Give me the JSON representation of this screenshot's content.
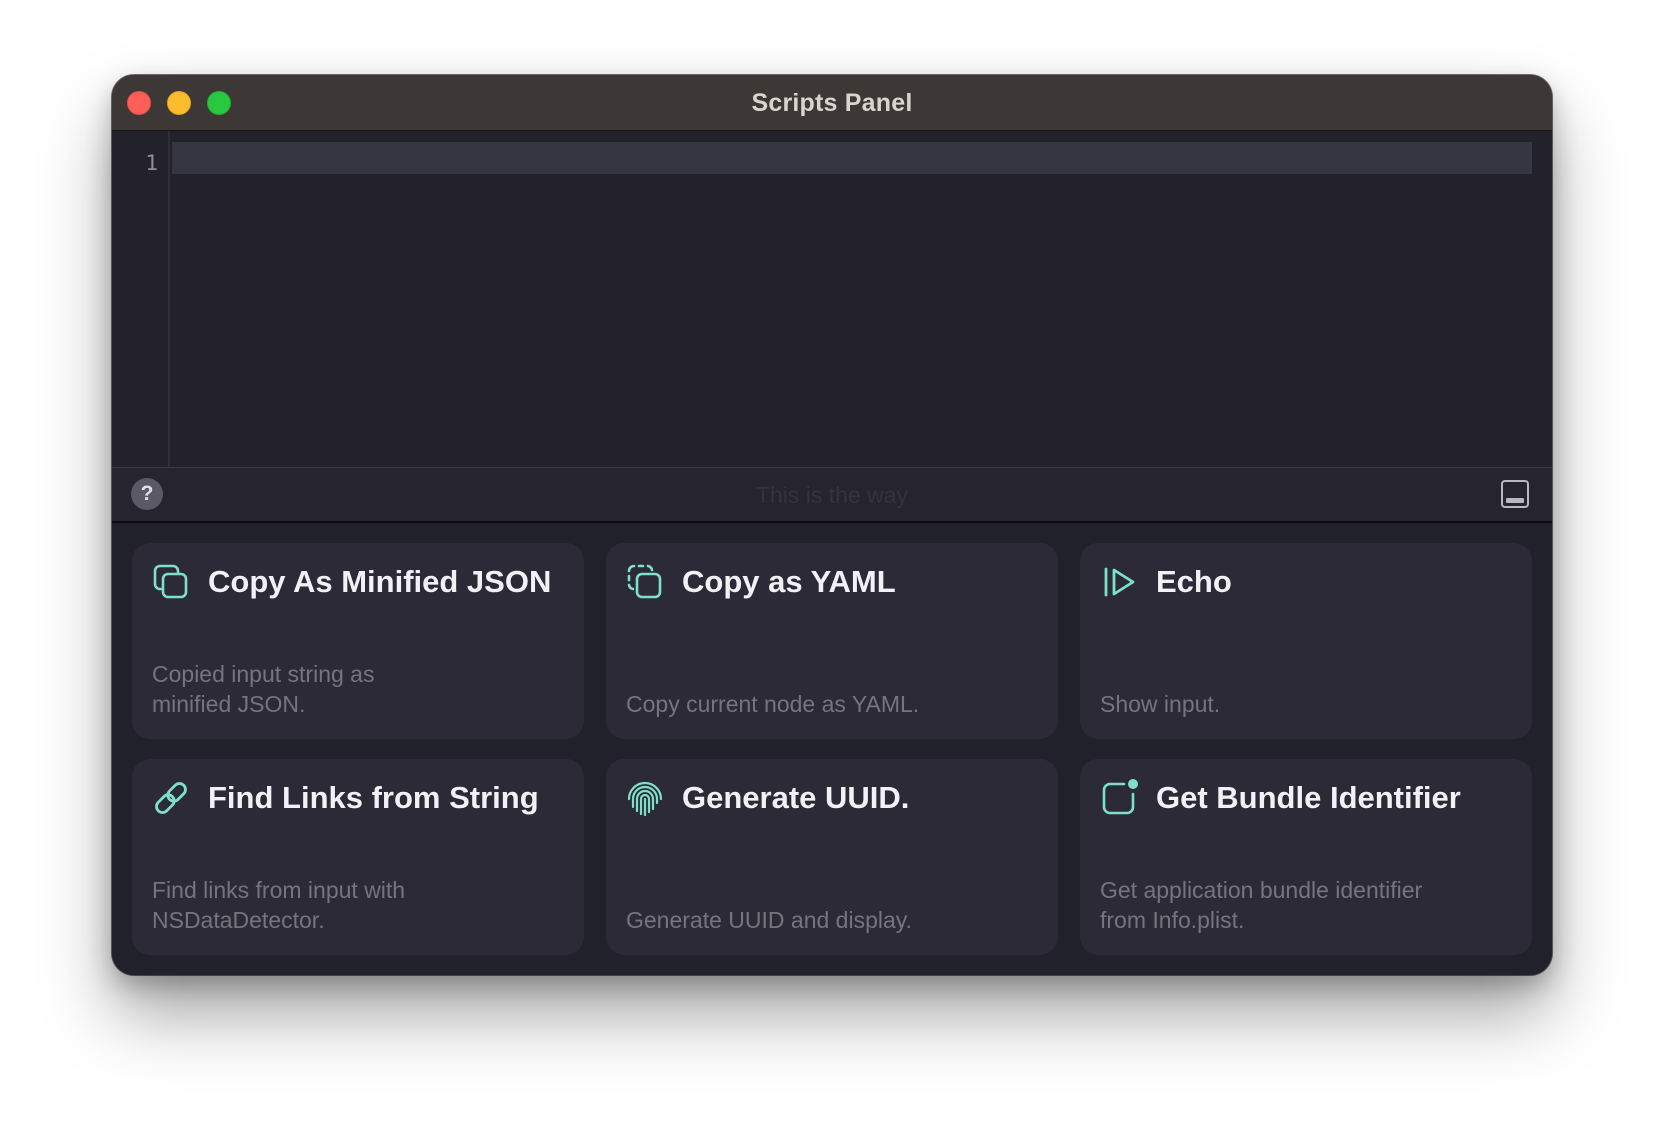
{
  "window": {
    "title": "Scripts Panel"
  },
  "editor": {
    "line_numbers": [
      "1"
    ],
    "content": ""
  },
  "statusbar": {
    "help_label": "?",
    "hint_text": "This is the way"
  },
  "colors": {
    "accent": "#7ee0c9",
    "card_background": "#2b2a36",
    "window_background": "#21212b",
    "titlebar": "#3d3835"
  },
  "scripts": [
    {
      "title": "Copy As Minified JSON",
      "description": "Copied input string as\nminified JSON.",
      "icon": "copy-icon"
    },
    {
      "title": "Copy as YAML",
      "description": "Copy current node as YAML.",
      "icon": "copy-dashed-icon"
    },
    {
      "title": "Echo",
      "description": "Show input.",
      "icon": "play-icon"
    },
    {
      "title": "Find Links from String",
      "description": "Find links from input with\nNSDataDetector.",
      "icon": "link-icon"
    },
    {
      "title": "Generate UUID.",
      "description": "Generate UUID and display.",
      "icon": "fingerprint-icon"
    },
    {
      "title": "Get Bundle Identifier",
      "description": "Get application bundle identifier\nfrom Info.plist.",
      "icon": "app-badge-icon"
    }
  ]
}
